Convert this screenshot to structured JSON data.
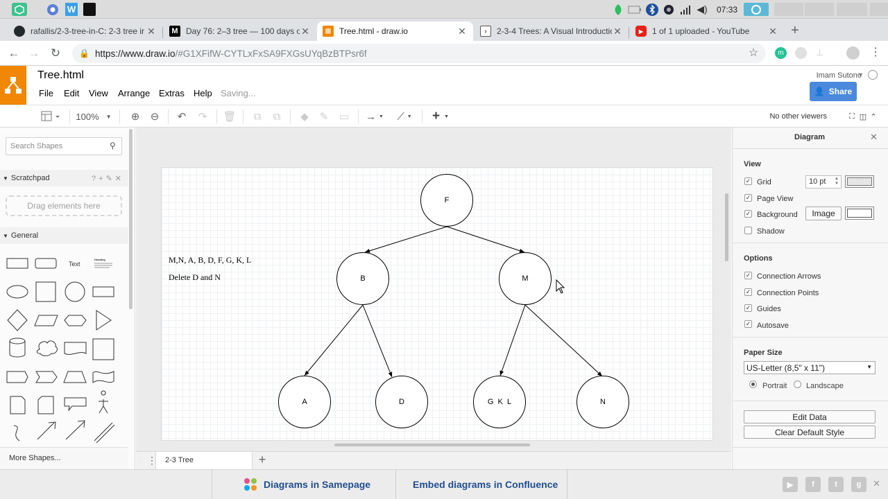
{
  "os": {
    "clock": "07:33"
  },
  "tabs": [
    {
      "title": "rafallis/2-3-tree-in-C: 2-3 tree ir",
      "icon": "github-icon"
    },
    {
      "title": "Day 76: 2–3 tree — 100 days of a",
      "icon": "medium-icon"
    },
    {
      "title": "Tree.html - draw.io",
      "icon": "drawio-icon"
    },
    {
      "title": "2-3-4 Trees: A Visual Introductio",
      "icon": "terminal-icon"
    },
    {
      "title": "1 of 1 uploaded - YouTube",
      "icon": "youtube-icon"
    }
  ],
  "address": {
    "host": "https://www.draw.io",
    "rest": "/#G1XFifW-CYTLxFxSA9FXGsUYqBzBTPsr6f"
  },
  "app": {
    "file_title": "Tree.html",
    "menus": [
      "File",
      "Edit",
      "View",
      "Arrange",
      "Extras",
      "Help"
    ],
    "status": "Saving...",
    "user": "Imam Sutono",
    "share_label": "Share",
    "zoom": "100%",
    "no_viewers": "No other viewers"
  },
  "left": {
    "search_placeholder": "Search Shapes",
    "scratchpad": "Scratchpad",
    "scratchpad_help": "?",
    "drag_text": "Drag elements here",
    "general": "General",
    "shape_text_label": "Text",
    "shape_heading_label": "Heading",
    "more_shapes": "More Shapes..."
  },
  "diagram": {
    "notes": [
      "M,N, A, B, D, F, G, K, L",
      "Delete D and N"
    ],
    "nodes": {
      "F": "F",
      "B": "B",
      "M": "M",
      "A": "A",
      "D": "D",
      "GKL": "G  K  L",
      "N": "N"
    },
    "page_tab": "2-3 Tree"
  },
  "right": {
    "title": "Diagram",
    "view_label": "View",
    "grid": {
      "label": "Grid",
      "checked": true,
      "size": "10 pt"
    },
    "page_view": {
      "label": "Page View",
      "checked": true
    },
    "background": {
      "label": "Background",
      "checked": true,
      "button": "Image"
    },
    "shadow": {
      "label": "Shadow",
      "checked": false
    },
    "options_label": "Options",
    "options": [
      {
        "label": "Connection Arrows",
        "checked": true
      },
      {
        "label": "Connection Points",
        "checked": true
      },
      {
        "label": "Guides",
        "checked": true
      },
      {
        "label": "Autosave",
        "checked": true
      }
    ],
    "paper_size_label": "Paper Size",
    "paper_size": "US-Letter (8,5\" x 11\")",
    "portrait": "Portrait",
    "landscape": "Landscape",
    "edit_data": "Edit Data",
    "clear_style": "Clear Default Style"
  },
  "footer": {
    "samepage": "Diagrams in Samepage",
    "confluence": "Embed diagrams in Confluence"
  },
  "colors": {
    "drawio_orange": "#f08705",
    "share_blue": "#4a89dc",
    "footer_link": "#1f4d8f"
  }
}
